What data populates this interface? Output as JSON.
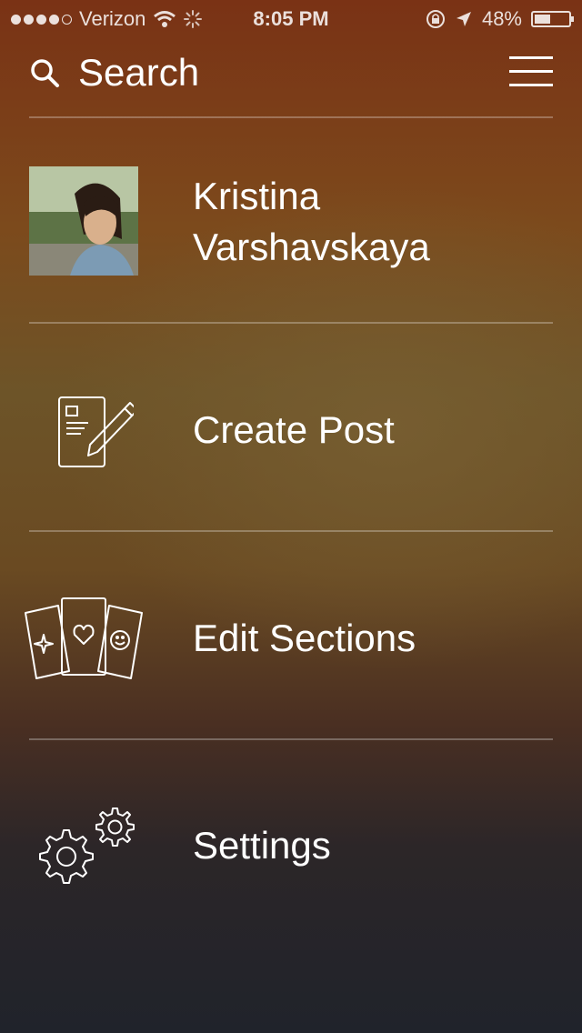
{
  "statusbar": {
    "carrier": "Verizon",
    "time": "8:05 PM",
    "battery": "48%",
    "battery_level": 0.48
  },
  "header": {
    "search_label": "Search"
  },
  "profile": {
    "first_name": "Kristina",
    "last_name": "Varshavskaya"
  },
  "menu": {
    "create_post": "Create Post",
    "edit_sections": "Edit Sections",
    "settings": "Settings"
  },
  "icons": {
    "search": "search-icon",
    "menu": "hamburger-menu-icon",
    "create_post": "compose-icon",
    "edit_sections": "cards-icon",
    "settings": "gears-icon"
  }
}
